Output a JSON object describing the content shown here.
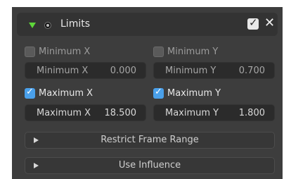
{
  "header": {
    "title": "Limits",
    "enabled": true,
    "close_symbol": "✕",
    "check_symbol": "✓"
  },
  "limits": {
    "min_x": {
      "checkbox_label": "Minimum X",
      "checked": false,
      "field_label": "Minimum X",
      "value": "0.000"
    },
    "min_y": {
      "checkbox_label": "Minimum Y",
      "checked": false,
      "field_label": "Minimum Y",
      "value": "0.700"
    },
    "max_x": {
      "checkbox_label": "Maximum X",
      "checked": true,
      "field_label": "Maximum X",
      "value": "18.500"
    },
    "max_y": {
      "checkbox_label": "Maximum Y",
      "checked": true,
      "field_label": "Maximum Y",
      "value": "1.800"
    }
  },
  "subpanels": [
    {
      "label": "Restrict Frame Range",
      "collapsed": true
    },
    {
      "label": "Use Influence",
      "collapsed": true
    }
  ],
  "colors": {
    "accent_blue": "#4aa0ea",
    "expand_green": "#5ed63a",
    "panel_bg": "#3d3d3d",
    "field_bg": "#2b2b2b"
  },
  "icons": [
    "expand-triangle-icon",
    "record-dot-icon",
    "checkmark-icon",
    "close-icon",
    "disclosure-arrow-icon"
  ]
}
